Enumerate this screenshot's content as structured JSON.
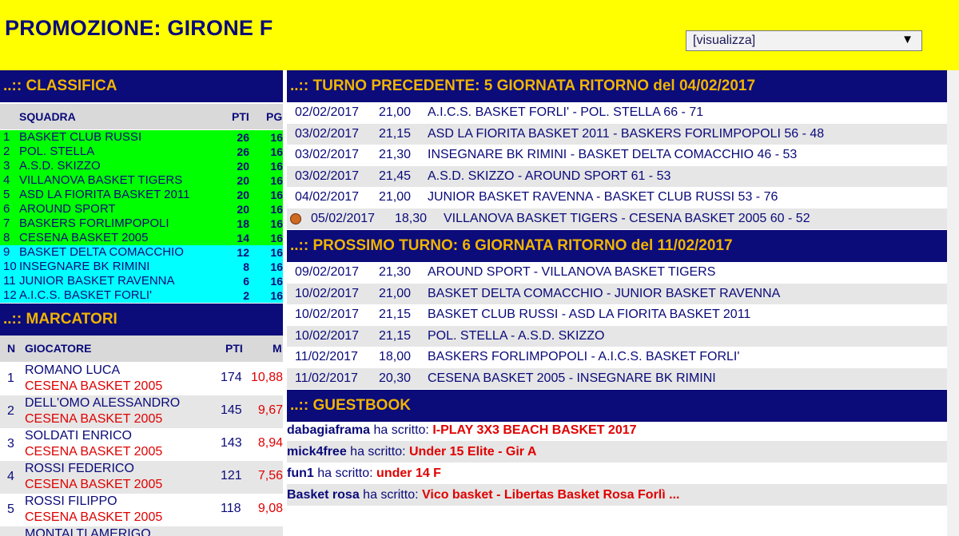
{
  "page_title": "PROMOZIONE: GIRONE F",
  "select": {
    "value": "[visualizza]",
    "arrow": "▼"
  },
  "classifica": {
    "heading": "..:: CLASSIFICA",
    "col_team": "SQUADRA",
    "col_pti": "PTI",
    "col_pg": "PG",
    "rows": [
      {
        "pos": "1",
        "team": "BASKET CLUB RUSSI",
        "pti": "26",
        "pg": "16"
      },
      {
        "pos": "2",
        "team": "POL. STELLA",
        "pti": "26",
        "pg": "16"
      },
      {
        "pos": "3",
        "team": "A.S.D. SKIZZO",
        "pti": "20",
        "pg": "16"
      },
      {
        "pos": "4",
        "team": "VILLANOVA BASKET TIGERS",
        "pti": "20",
        "pg": "16"
      },
      {
        "pos": "5",
        "team": "ASD LA FIORITA BASKET 2011",
        "pti": "20",
        "pg": "16"
      },
      {
        "pos": "6",
        "team": "AROUND SPORT",
        "pti": "20",
        "pg": "16"
      },
      {
        "pos": "7",
        "team": "BASKERS FORLIMPOPOLI",
        "pti": "18",
        "pg": "16"
      },
      {
        "pos": "8",
        "team": "CESENA BASKET 2005",
        "pti": "14",
        "pg": "16"
      },
      {
        "pos": "9",
        "team": "BASKET DELTA COMACCHIO",
        "pti": "12",
        "pg": "16"
      },
      {
        "pos": "10",
        "team": "INSEGNARE BK RIMINI",
        "pti": "8",
        "pg": "16"
      },
      {
        "pos": "11",
        "team": "JUNIOR BASKET RAVENNA",
        "pti": "6",
        "pg": "16"
      },
      {
        "pos": "12",
        "team": "A.I.C.S. BASKET FORLI'",
        "pti": "2",
        "pg": "16"
      }
    ]
  },
  "marcatori": {
    "heading": "..:: MARCATORI",
    "col_n": "N",
    "col_player": "GIOCATORE",
    "col_pti": "PTI",
    "col_m": "M",
    "rows": [
      {
        "n": "1",
        "name": "ROMANO LUCA",
        "club": "CESENA BASKET 2005",
        "pti": "174",
        "avg": "10,88"
      },
      {
        "n": "2",
        "name": "DELL'OMO ALESSANDRO",
        "club": "CESENA BASKET 2005",
        "pti": "145",
        "avg": "9,67"
      },
      {
        "n": "3",
        "name": "SOLDATI ENRICO",
        "club": "CESENA BASKET 2005",
        "pti": "143",
        "avg": "8,94"
      },
      {
        "n": "4",
        "name": "ROSSI FEDERICO",
        "club": "CESENA BASKET 2005",
        "pti": "121",
        "avg": "7,56"
      },
      {
        "n": "5",
        "name": "ROSSI FILIPPO",
        "club": "CESENA BASKET 2005",
        "pti": "118",
        "avg": "9,08"
      },
      {
        "n": "",
        "name": "MONTALTI AMERIGO",
        "club": "",
        "pti": "",
        "avg": ""
      }
    ]
  },
  "turno_precedente": {
    "heading": "..:: TURNO PRECEDENTE:  5 GIORNATA RITORNO del 04/02/2017",
    "rows": [
      {
        "date": "02/02/2017",
        "time": "21,00",
        "game": "A.I.C.S. BASKET FORLI'  -  POL. STELLA  66 - 71"
      },
      {
        "date": "03/02/2017",
        "time": "21,15",
        "game": "ASD LA FIORITA BASKET 2011  -  BASKERS FORLIMPOPOLI  56 - 48"
      },
      {
        "date": "03/02/2017",
        "time": "21,30",
        "game": "INSEGNARE BK RIMINI  -  BASKET DELTA COMACCHIO  46 - 53"
      },
      {
        "date": "03/02/2017",
        "time": "21,45",
        "game": "A.S.D. SKIZZO  -  AROUND SPORT  61 - 53"
      },
      {
        "date": "04/02/2017",
        "time": "21,00",
        "game": "JUNIOR BASKET RAVENNA  -  BASKET CLUB RUSSI  53 - 76"
      },
      {
        "date": "05/02/2017",
        "time": "18,30",
        "game": "VILLANOVA BASKET TIGERS  -  CESENA BASKET 2005  60 - 52"
      }
    ]
  },
  "prossimo_turno": {
    "heading": "..:: PROSSIMO TURNO:  6 GIORNATA RITORNO del 11/02/2017",
    "rows": [
      {
        "date": "09/02/2017",
        "time": "21,30",
        "game": "AROUND SPORT  -  VILLANOVA BASKET TIGERS"
      },
      {
        "date": "10/02/2017",
        "time": "21,00",
        "game": "BASKET DELTA COMACCHIO  -  JUNIOR BASKET RAVENNA"
      },
      {
        "date": "10/02/2017",
        "time": "21,15",
        "game": "BASKET CLUB RUSSI  -  ASD LA FIORITA BASKET 2011"
      },
      {
        "date": "10/02/2017",
        "time": "21,15",
        "game": "POL. STELLA  -  A.S.D. SKIZZO"
      },
      {
        "date": "11/02/2017",
        "time": "18,00",
        "game": "BASKERS FORLIMPOPOLI  -  A.I.C.S. BASKET FORLI'"
      },
      {
        "date": "11/02/2017",
        "time": "20,30",
        "game": "CESENA BASKET 2005  -  INSEGNARE BK RIMINI"
      }
    ]
  },
  "guestbook": {
    "heading": "..:: GUESTBOOK",
    "wrote": "ha scritto:",
    "rows": [
      {
        "user": "dabagiaframa",
        "msg": "I-PLAY 3X3 BEACH BASKET 2017"
      },
      {
        "user": "mick4free",
        "msg": "Under 15 Elite - Gir A"
      },
      {
        "user": "fun1",
        "msg": "under 14 F"
      },
      {
        "user": "Basket rosa",
        "msg": "Vico basket - Libertas Basket Rosa Forlì ..."
      }
    ]
  },
  "icons": {
    "ball": "basketball-icon"
  },
  "colors": {
    "header_bg": "#ffff00",
    "section_bg": "#0b0b7a",
    "section_text": "#f0b400",
    "promo": "#00ff00",
    "mid": "#00ffff",
    "club_red": "#e00000"
  }
}
